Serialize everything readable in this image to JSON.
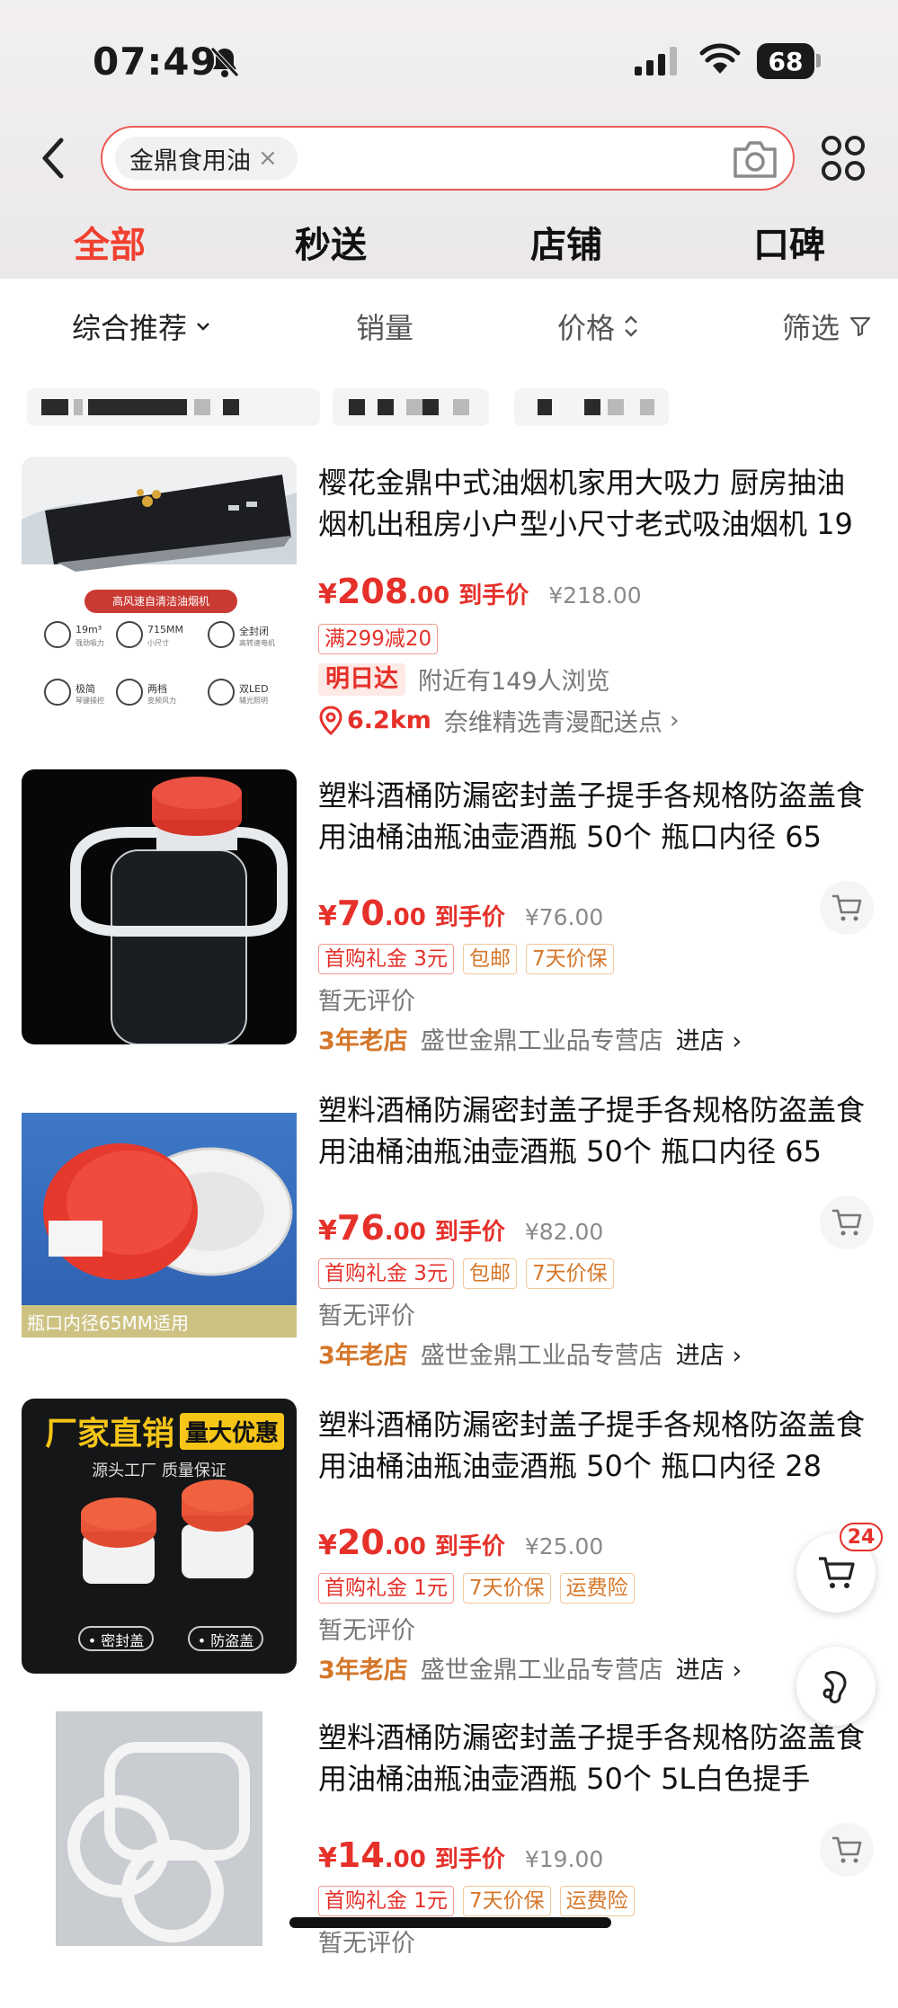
{
  "status_bar": {
    "time": "07:49",
    "battery": "68"
  },
  "search": {
    "query": "金鼎食用油",
    "clear": "×"
  },
  "tabs": [
    {
      "label": "全部",
      "active": true
    },
    {
      "label": "秒送",
      "active": false
    },
    {
      "label": "店铺",
      "active": false
    },
    {
      "label": "口碑",
      "active": false
    }
  ],
  "sort": {
    "comprehensive": "综合推荐",
    "sales": "销量",
    "price": "价格",
    "filter": "筛选"
  },
  "colors": {
    "accent": "#e5312a",
    "tab_active": "#f0402f",
    "store_age": "#d5772a"
  },
  "products": [
    {
      "title": "樱花金鼎中式油烟机家用大吸力 厨房抽油烟机出租房小户型小尺寸老式吸油烟机 19",
      "price_yen": "¥",
      "price_int": "208",
      "price_dec": ".00",
      "price_label": "到手价",
      "original": "¥218.00",
      "promo": "满299减20",
      "delivery_badge": "明日达",
      "viewers": "附近有149人浏览",
      "distance": "6.2km",
      "shop": "奈维精选青漫配送点",
      "image": {
        "banner": "高风速自清洁油烟机",
        "spec1": "19m³",
        "spec2": "715MM",
        "spec3": "全封闭",
        "spec4": "极简",
        "spec5": "两档",
        "spec6": "双LED",
        "sub1": "强劲吸力",
        "sub2": "小尺寸",
        "sub3": "高转速电机",
        "sub4": "琴键操控",
        "sub5": "变频风力",
        "sub6": "辅光照明"
      }
    },
    {
      "title": "塑料酒桶防漏密封盖子提手各规格防盗盖食用油桶油瓶油壶酒瓶 50个 瓶口内径 65",
      "price_yen": "¥",
      "price_int": "70",
      "price_dec": ".00",
      "price_label": "到手价",
      "original": "¥76.00",
      "tags": [
        "首购礼金 3元",
        "包邮",
        "7天价保"
      ],
      "review": "暂无评价",
      "store_age": "3年老店",
      "store": "盛世金鼎工业品专营店",
      "store_go": "进店 ›"
    },
    {
      "title": "塑料酒桶防漏密封盖子提手各规格防盗盖食用油桶油瓶油壶酒瓶 50个 瓶口内径 65",
      "price_yen": "¥",
      "price_int": "76",
      "price_dec": ".00",
      "price_label": "到手价",
      "original": "¥82.00",
      "tags": [
        "首购礼金 3元",
        "包邮",
        "7天价保"
      ],
      "review": "暂无评价",
      "store_age": "3年老店",
      "store": "盛世金鼎工业品专营店",
      "store_go": "进店 ›",
      "image_caption": "瓶口内径65MM适用"
    },
    {
      "title": "塑料酒桶防漏密封盖子提手各规格防盗盖食用油桶油瓶油壶酒瓶 50个 瓶口内径 28",
      "price_yen": "¥",
      "price_int": "20",
      "price_dec": ".00",
      "price_label": "到手价",
      "original": "¥25.00",
      "tags": [
        "首购礼金 1元",
        "7天价保",
        "运费险"
      ],
      "review": "暂无评价",
      "store_age": "3年老店",
      "store": "盛世金鼎工业品专营店",
      "store_go": "进店 ›",
      "image_text": {
        "headline": "厂家直销",
        "highlight": "量大优惠",
        "sub": "源头工厂  质量保证",
        "label1": "• 密封盖",
        "label2": "• 防盗盖"
      }
    },
    {
      "title": "塑料酒桶防漏密封盖子提手各规格防盗盖食用油桶油瓶油壶酒瓶 50个 5L白色提手",
      "price_yen": "¥",
      "price_int": "14",
      "price_dec": ".00",
      "price_label": "到手价",
      "original": "¥19.00",
      "tags": [
        "首购礼金 1元",
        "7天价保",
        "运费险"
      ],
      "review": "暂无评价"
    }
  ],
  "cart_badge": "24"
}
